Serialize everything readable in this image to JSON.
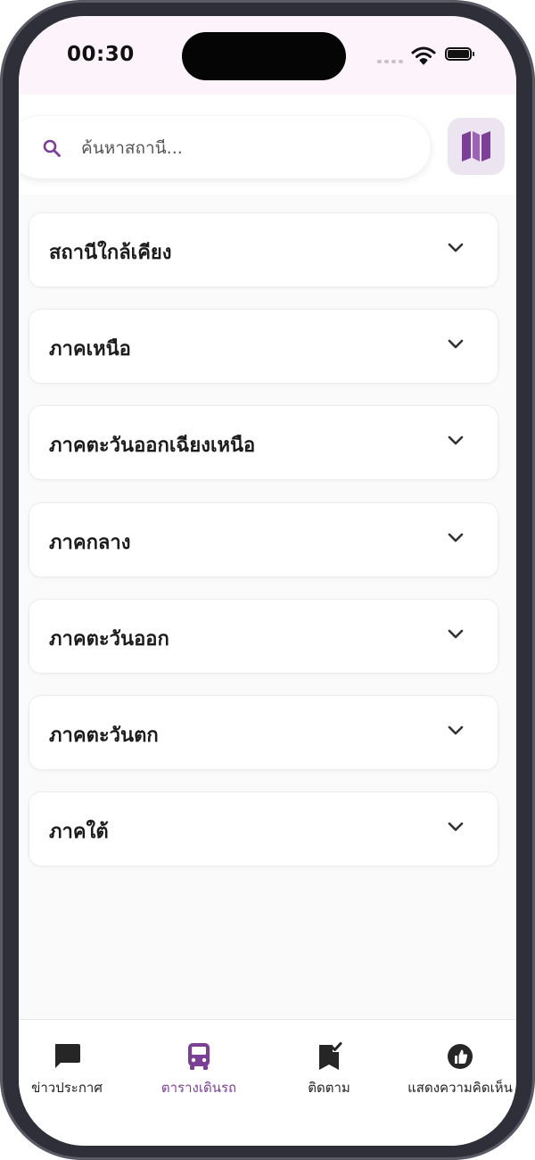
{
  "status_bar": {
    "time": "00:30"
  },
  "search": {
    "placeholder": "ค้นหาสถานี...",
    "value": "",
    "icon": "search-icon",
    "map_button_icon": "map-icon"
  },
  "regions": [
    {
      "label": "สถานีใกล้เคียง",
      "icon": "chevron-down-icon"
    },
    {
      "label": "ภาคเหนือ",
      "icon": "chevron-down-icon"
    },
    {
      "label": "ภาคตะวันออกเฉียงเหนือ",
      "icon": "chevron-down-icon"
    },
    {
      "label": "ภาคกลาง",
      "icon": "chevron-down-icon"
    },
    {
      "label": "ภาคตะวันออก",
      "icon": "chevron-down-icon"
    },
    {
      "label": "ภาคตะวันตก",
      "icon": "chevron-down-icon"
    },
    {
      "label": "ภาคใต้",
      "icon": "chevron-down-icon"
    }
  ],
  "bottom_nav": {
    "items": [
      {
        "label": "ข่าวประกาศ",
        "icon": "chat-bubble-icon",
        "active": false
      },
      {
        "label": "ตารางเดินรถ",
        "icon": "bus-icon",
        "active": true
      },
      {
        "label": "ติดตาม",
        "icon": "bookmark-check-icon",
        "active": false
      },
      {
        "label": "แสดงความคิดเห็น",
        "icon": "thumb-up-icon",
        "active": false
      }
    ]
  },
  "colors": {
    "accent": "#7b3f98",
    "accent_light": "#ece5f1",
    "status_bar_bg": "#fcf3fb",
    "page_bg": "#fafafa"
  }
}
